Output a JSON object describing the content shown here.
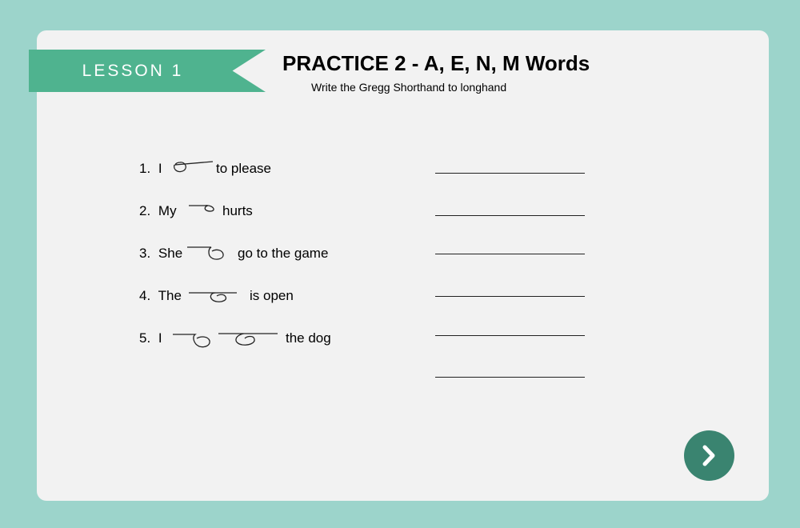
{
  "header": {
    "lesson_label": "LESSON 1",
    "title": "PRACTICE 2 - A, E, N, M Words",
    "subtitle": "Write the Gregg Shorthand to longhand"
  },
  "items": [
    {
      "number": "1.",
      "before": "I",
      "after": "to please",
      "shorthand": "shorthand-outline"
    },
    {
      "number": "2.",
      "before": "My",
      "after": "hurts",
      "shorthand": "shorthand-outline"
    },
    {
      "number": "3.",
      "before": "She",
      "after": "go to the game",
      "shorthand": "shorthand-outline"
    },
    {
      "number": "4.",
      "before": "The",
      "after": "is open",
      "shorthand": "shorthand-outline"
    },
    {
      "number": "5.",
      "before": "I",
      "after": "the dog",
      "shorthand": "shorthand-outline"
    }
  ],
  "answer_lines": 6,
  "next_button": {
    "icon": "chevron-right-icon"
  },
  "colors": {
    "background": "#9cd4cb",
    "card": "#f2f2f2",
    "ribbon": "#4fb38f",
    "next_button": "#3a8470"
  }
}
